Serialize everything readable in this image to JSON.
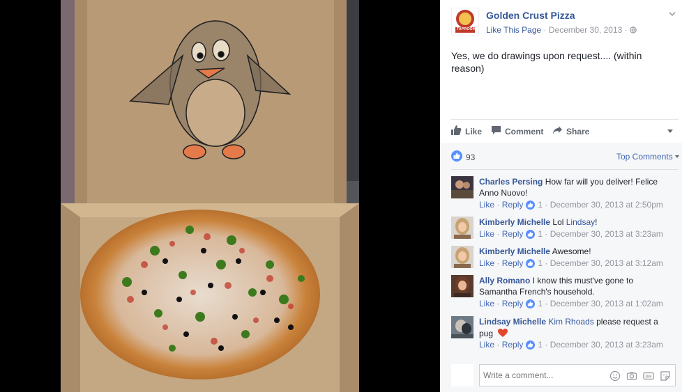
{
  "post": {
    "page_name": "Golden Crust Pizza",
    "like_page": "Like This Page",
    "date": "December 30, 2013",
    "separator": "·",
    "text": "Yes, we do drawings upon request.... (within reason)",
    "avatar_text": "TAPROOM"
  },
  "actions": {
    "like": "Like",
    "comment": "Comment",
    "share": "Share"
  },
  "reactions": {
    "count": "93",
    "top_comments": "Top Comments"
  },
  "comment_actions": {
    "like": "Like",
    "reply": "Reply",
    "dot": "·"
  },
  "comments": [
    {
      "name": "Charles Persing",
      "text": "How far will you deliver! Felice Anno Nuovo!",
      "likes": "1",
      "time": "December 30, 2013 at 2:50pm"
    },
    {
      "name": "Kimberly Michelle",
      "text_prefix": "Lol ",
      "mention": "Lindsay",
      "text_suffix": "!",
      "likes": "1",
      "time": "December 30, 2013 at 3:23am"
    },
    {
      "name": "Kimberly Michelle",
      "text": "Awesome!",
      "likes": "1",
      "time": "December 30, 2013 at 3:12am"
    },
    {
      "name": "Ally Romano",
      "text": "I know this must've gone to Samantha French's household.",
      "likes": "1",
      "time": "December 30, 2013 at 1:02am"
    },
    {
      "name": "Lindsay Michelle",
      "mention": "Kim Rhoads",
      "text": " please request a pug",
      "likes": "1",
      "time": "December 30, 2013 at 3:23am"
    }
  ],
  "composer": {
    "placeholder": "Write a comment..."
  },
  "icons": {
    "like": "thumbs-up-icon",
    "comment": "speech-bubble-icon",
    "share": "share-arrow-icon",
    "emoji": "emoji-icon",
    "camera": "camera-icon",
    "gif": "gif-icon",
    "sticker": "sticker-icon",
    "globe": "globe-icon",
    "heart": "heart-emoji-icon"
  },
  "colors": {
    "link": "#365899",
    "accent": "#4267b2",
    "muted": "#90949c",
    "panel_bg": "#f6f7f9",
    "heart": "#e0472c"
  }
}
